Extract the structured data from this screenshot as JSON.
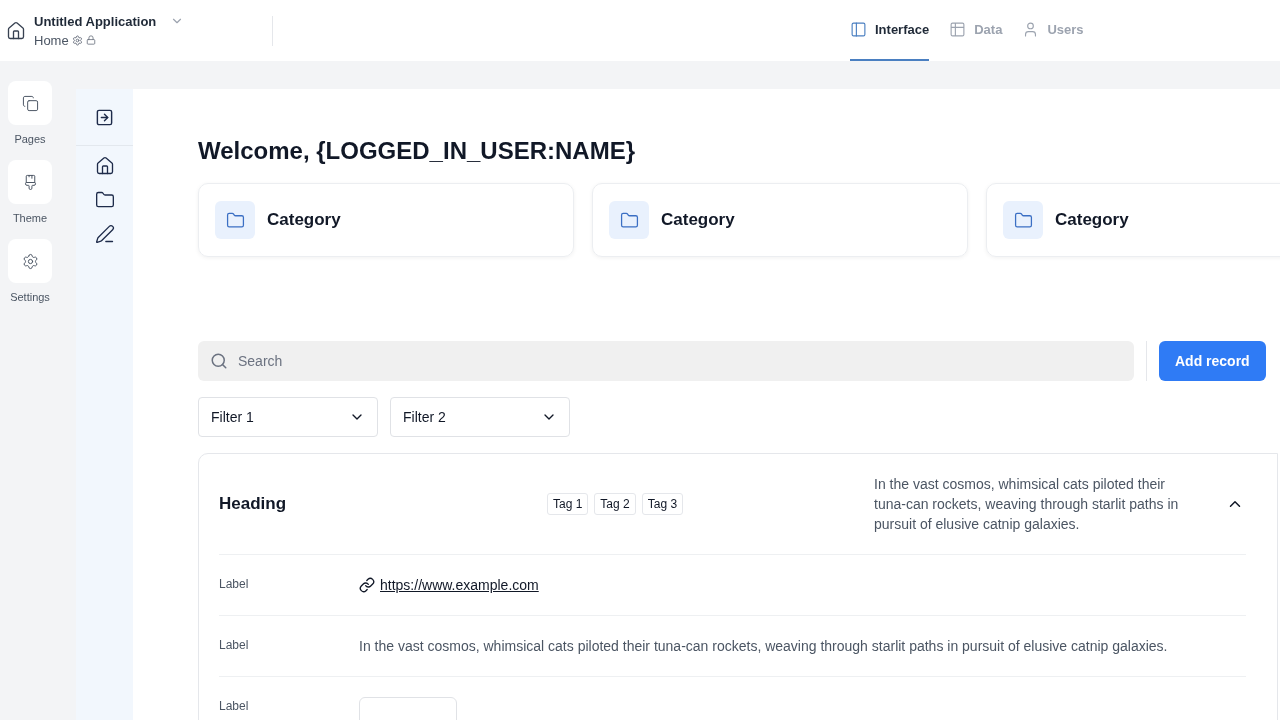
{
  "app": {
    "title": "Untitled Application",
    "page": "Home"
  },
  "tabs": [
    {
      "label": "Interface",
      "selected": true
    },
    {
      "label": "Data",
      "selected": false
    },
    {
      "label": "Users",
      "selected": false
    }
  ],
  "rail": [
    {
      "label": "Pages"
    },
    {
      "label": "Theme"
    },
    {
      "label": "Settings"
    }
  ],
  "welcome": "Welcome, {LOGGED_IN_USER:NAME}",
  "categories": [
    {
      "label": "Category"
    },
    {
      "label": "Category"
    },
    {
      "label": "Category"
    }
  ],
  "search": {
    "placeholder": "Search"
  },
  "add_button": "Add record",
  "filters": [
    "Filter 1",
    "Filter 2"
  ],
  "record": {
    "heading": "Heading",
    "expanded": true,
    "tags": [
      "Tag 1",
      "Tag 2",
      "Tag 3"
    ],
    "description": "In the vast cosmos, whimsical cats piloted their tuna-can rockets, weaving through starlit paths in pursuit of elusive catnip galaxies.",
    "fields": [
      {
        "kind": "link",
        "label": "Label",
        "value": "https://www.example.com"
      },
      {
        "kind": "text",
        "label": "Label",
        "value": "In the vast cosmos, whimsical cats piloted their tuna-can rockets, weaving through starlit paths in pursuit of elusive catnip galaxies."
      },
      {
        "kind": "box",
        "label": "Label"
      }
    ]
  }
}
